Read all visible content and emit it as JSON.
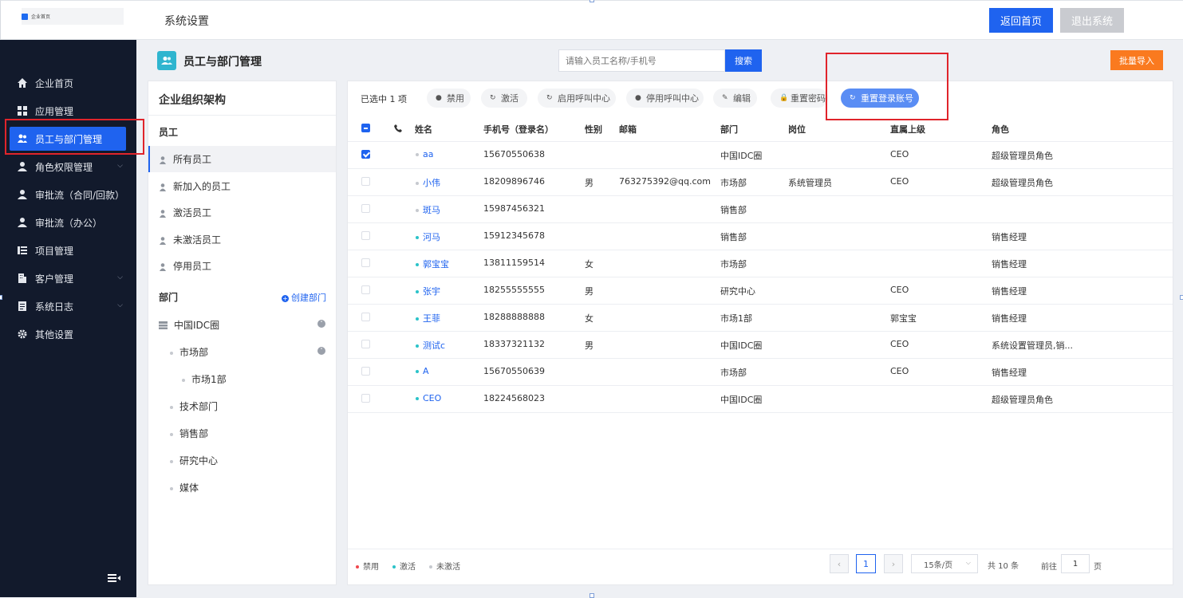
{
  "app": {
    "logo_text": "企业首页",
    "page_title": "系统设置"
  },
  "header": {
    "home_label": "返回首页",
    "exit_label": "退出系统"
  },
  "sidebar": {
    "items": [
      {
        "label": "企业首页",
        "icon": "home-icon"
      },
      {
        "label": "应用管理",
        "icon": "grid-icon"
      },
      {
        "label": "员工与部门管理",
        "icon": "users-icon",
        "active": true
      },
      {
        "label": "角色权限管理",
        "icon": "user-icon",
        "has_children": true
      },
      {
        "label": "审批流（合同/回款）",
        "icon": "user-icon"
      },
      {
        "label": "审批流（办公）",
        "icon": "user-icon"
      },
      {
        "label": "项目管理",
        "icon": "list-icon"
      },
      {
        "label": "客户管理",
        "icon": "building-icon",
        "has_children": true
      },
      {
        "label": "系统日志",
        "icon": "document-icon",
        "has_children": true
      },
      {
        "label": "其他设置",
        "icon": "gear-icon"
      }
    ]
  },
  "section": {
    "title": "员工与部门管理",
    "search_placeholder": "请输入员工名称/手机号",
    "search_label": "搜索",
    "import_label": "批量导入"
  },
  "org": {
    "title": "企业组织架构",
    "employee_heading": "员工",
    "employee_filters": [
      "所有员工",
      "新加入的员工",
      "激活员工",
      "未激活员工",
      "停用员工"
    ],
    "dept_heading": "部门",
    "create_dept_label": "创建部门",
    "departments": [
      {
        "label": "中国IDC圈",
        "level": 0,
        "expanded": true
      },
      {
        "label": "市场部",
        "level": 1,
        "expanded": true
      },
      {
        "label": "市场1部",
        "level": 2
      },
      {
        "label": "技术部门",
        "level": 1
      },
      {
        "label": "销售部",
        "level": 1
      },
      {
        "label": "研究中心",
        "level": 1
      },
      {
        "label": "媒体",
        "level": 1
      }
    ]
  },
  "toolbar": {
    "selected_text": "已选中 1 项",
    "actions": [
      "禁用",
      "激活",
      "启用呼叫中心",
      "停用呼叫中心",
      "编辑",
      "重置密码",
      "重置登录账号"
    ]
  },
  "table": {
    "headers": {
      "name": "姓名",
      "phone": "手机号（登录名）",
      "gender": "性别",
      "email": "邮箱",
      "dept": "部门",
      "post": "岗位",
      "leader": "直属上级",
      "role": "角色"
    },
    "rows": [
      {
        "name": "aa",
        "status": "inactive",
        "phone": "15670550638",
        "gender": "",
        "email": "",
        "dept": "中国IDC圈",
        "post": "",
        "leader": "CEO",
        "role": "超级管理员角色",
        "checked": true
      },
      {
        "name": "小伟",
        "status": "inactive",
        "phone": "18209896746",
        "gender": "男",
        "email": "763275392@qq.com",
        "dept": "市场部",
        "post": "系统管理员",
        "leader": "CEO",
        "role": "超级管理员角色"
      },
      {
        "name": "斑马",
        "status": "inactive",
        "phone": "15987456321",
        "gender": "",
        "email": "",
        "dept": "销售部",
        "post": "",
        "leader": "",
        "role": ""
      },
      {
        "name": "河马",
        "status": "active",
        "phone": "15912345678",
        "gender": "",
        "email": "",
        "dept": "销售部",
        "post": "",
        "leader": "",
        "role": "销售经理"
      },
      {
        "name": "郭宝宝",
        "status": "active",
        "phone": "13811159514",
        "gender": "女",
        "email": "",
        "dept": "市场部",
        "post": "",
        "leader": "",
        "role": "销售经理"
      },
      {
        "name": "张宇",
        "status": "active",
        "phone": "18255555555",
        "gender": "男",
        "email": "",
        "dept": "研究中心",
        "post": "",
        "leader": "CEO",
        "role": "销售经理"
      },
      {
        "name": "王菲",
        "status": "active",
        "phone": "18288888888",
        "gender": "女",
        "email": "",
        "dept": "市场1部",
        "post": "",
        "leader": "郭宝宝",
        "role": "销售经理"
      },
      {
        "name": "测试c",
        "status": "active",
        "phone": "18337321132",
        "gender": "男",
        "email": "",
        "dept": "中国IDC圈",
        "post": "",
        "leader": "CEO",
        "role": "系统设置管理员,销..."
      },
      {
        "name": "A",
        "status": "active",
        "phone": "15670550639",
        "gender": "",
        "email": "",
        "dept": "市场部",
        "post": "",
        "leader": "CEO",
        "role": "销售经理"
      },
      {
        "name": "CEO",
        "status": "active",
        "phone": "18224568023",
        "gender": "",
        "email": "",
        "dept": "中国IDC圈",
        "post": "",
        "leader": "",
        "role": "超级管理员角色"
      }
    ]
  },
  "legend": [
    {
      "label": "禁用",
      "color": "#f0474d"
    },
    {
      "label": "激活",
      "color": "#2bc3c9"
    },
    {
      "label": "未激活",
      "color": "#c6c9cf"
    }
  ],
  "pagination": {
    "current": "1",
    "page_size": "15条/页",
    "total": "共 10 条",
    "goto_label": "前往",
    "goto_value": "1",
    "page_suffix": "页"
  },
  "colors": {
    "primary": "#1f63ef",
    "sidebar_bg": "#121a2c",
    "orange": "#fa7a1f",
    "highlight": "#e0242b"
  }
}
